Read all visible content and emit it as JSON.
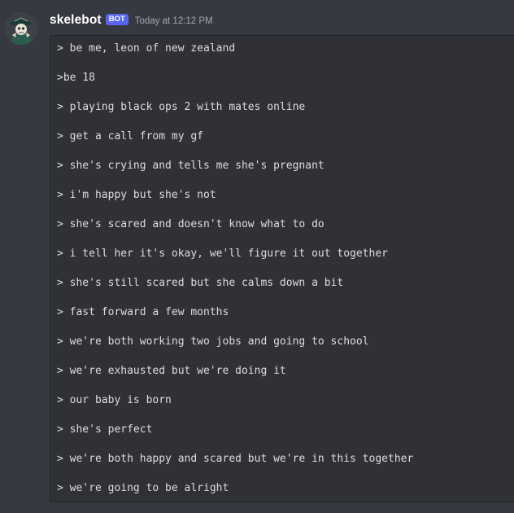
{
  "message": {
    "username": "skelebot",
    "bot_tag": "BOT",
    "timestamp": "Today at 12:12 PM",
    "avatar_icon": "skeleton-pirate-avatar",
    "lines": [
      "> be me, leon of new zealand",
      ">be 18",
      "> playing black ops 2 with mates online",
      "> get a call from my gf",
      "> she's crying and tells me she's pregnant",
      "> i'm happy but she's not",
      "> she's scared and doesn't know what to do",
      "> i tell her it's okay, we'll figure it out together",
      "> she's still scared but she calms down a bit",
      "> fast forward a few months",
      "> we're both working two jobs and going to school",
      "> we're exhausted but we're doing it",
      "> our baby is born",
      "> she's perfect",
      "> we're both happy and scared but we're in this together",
      "> we're going to be alright"
    ]
  },
  "colors": {
    "background": "#36393f",
    "code_background": "#2f3136",
    "code_border": "#202225",
    "username": "#ffffff",
    "bot_tag": "#5865f2",
    "timestamp": "#a3a6aa",
    "code_text": "#dcddde"
  }
}
